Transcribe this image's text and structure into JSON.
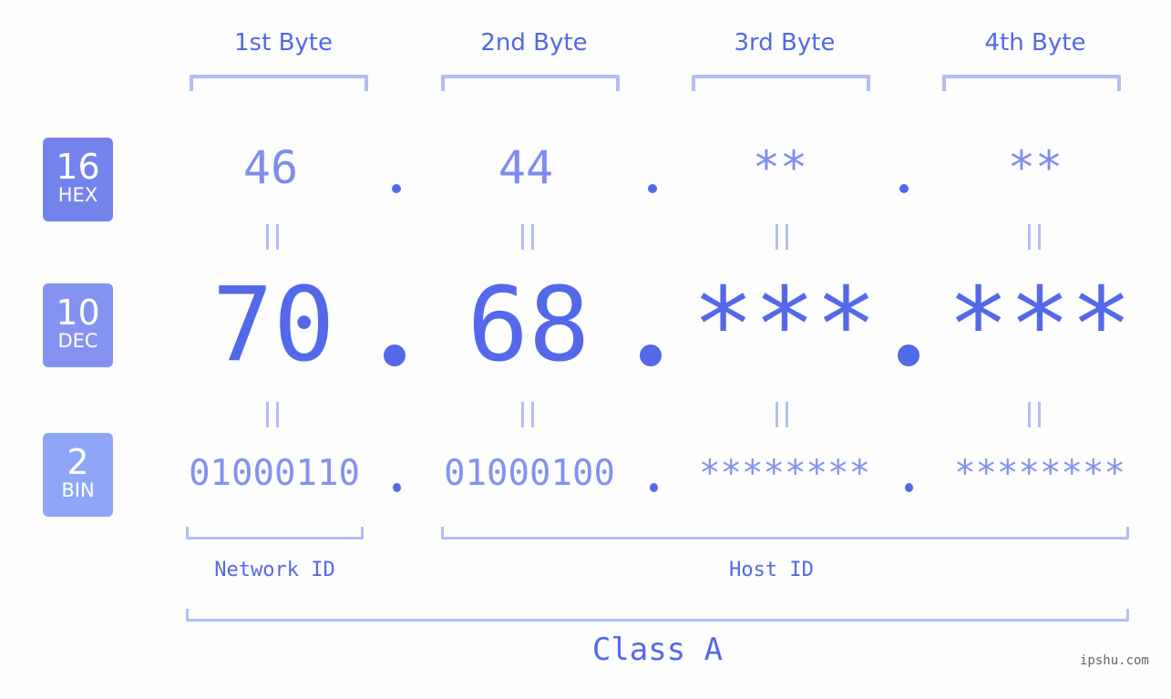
{
  "headers": [
    "1st Byte",
    "2nd Byte",
    "3rd Byte",
    "4th Byte"
  ],
  "badges": [
    {
      "num": "16",
      "label": "HEX",
      "color": "#7483ec"
    },
    {
      "num": "10",
      "label": "DEC",
      "color": "#8493f0"
    },
    {
      "num": "2",
      "label": "BIN",
      "color": "#8fa6f8"
    }
  ],
  "hex": [
    "46",
    "44",
    "**",
    "**"
  ],
  "dec": [
    "70",
    "68",
    "***",
    "***"
  ],
  "bin": [
    "01000110",
    "01000100",
    "********",
    "********"
  ],
  "equals": "=",
  "network_label": "Network ID",
  "host_label": "Host ID",
  "class_label": "Class A",
  "watermark": "ipshu.com",
  "colors": {
    "accent": "#5468e8",
    "bracket": "#b3bdf6",
    "hex_text": "#7d8cee",
    "bin_text": "#8292ef"
  }
}
